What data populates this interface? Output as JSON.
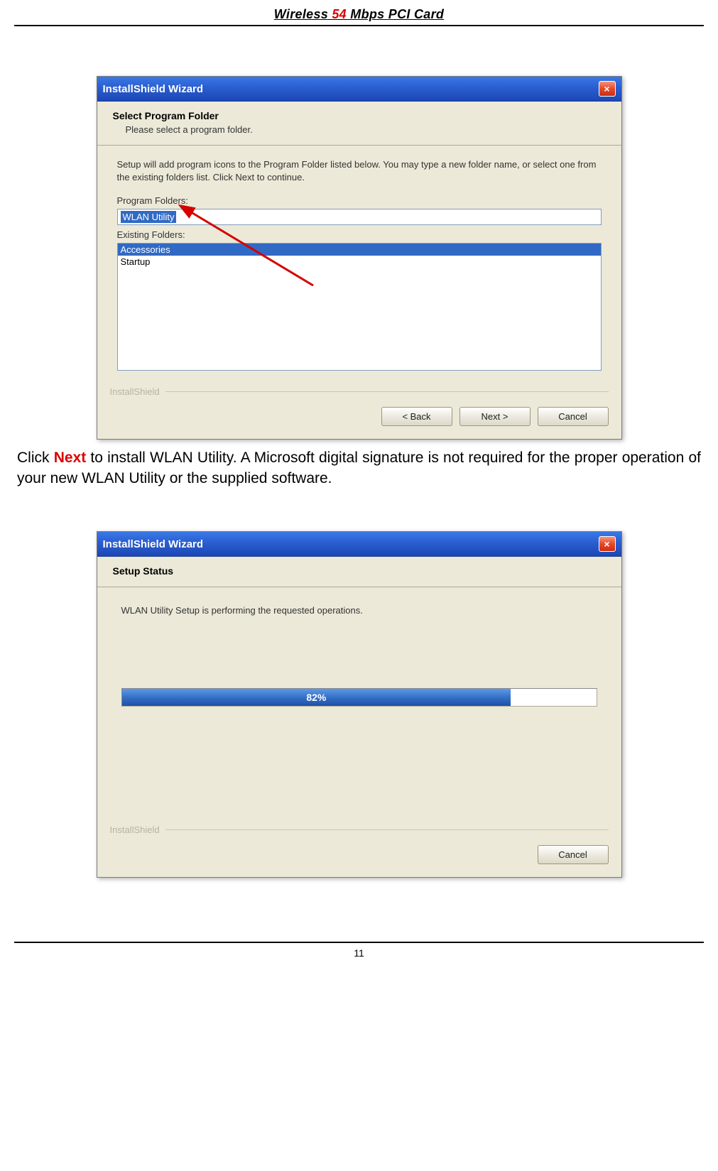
{
  "header": {
    "pre": "Wireless ",
    "mid": "54",
    "post": " Mbps PCI Card"
  },
  "dialog1": {
    "title": "InstallShield Wizard",
    "close": "×",
    "heading": "Select Program Folder",
    "subheading": "Please select a program folder.",
    "instruction": "Setup will add program icons to the Program Folder listed below.  You may type a new folder name, or select one from the existing folders list.  Click Next to continue.",
    "label_folders": "Program Folders:",
    "folder_value": "WLAN Utility",
    "label_existing": "Existing Folders:",
    "existing": [
      "Accessories",
      "Startup"
    ],
    "brand": "InstallShield",
    "btn_back": "< Back",
    "btn_next": "Next >",
    "btn_cancel": "Cancel"
  },
  "bodytext": {
    "t1": "Click ",
    "next_word": "Next",
    "t2": " to install WLAN Utility.  A Microsoft digital signature is not required for the proper operation of your new WLAN Utility or the supplied software."
  },
  "dialog2": {
    "title": "InstallShield Wizard",
    "close": "×",
    "heading": "Setup Status",
    "status": "WLAN Utility Setup is performing the requested operations.",
    "progress_pct": "82%",
    "progress_width": "82%",
    "brand": "InstallShield",
    "btn_cancel": "Cancel"
  },
  "footer": {
    "page": "11"
  }
}
